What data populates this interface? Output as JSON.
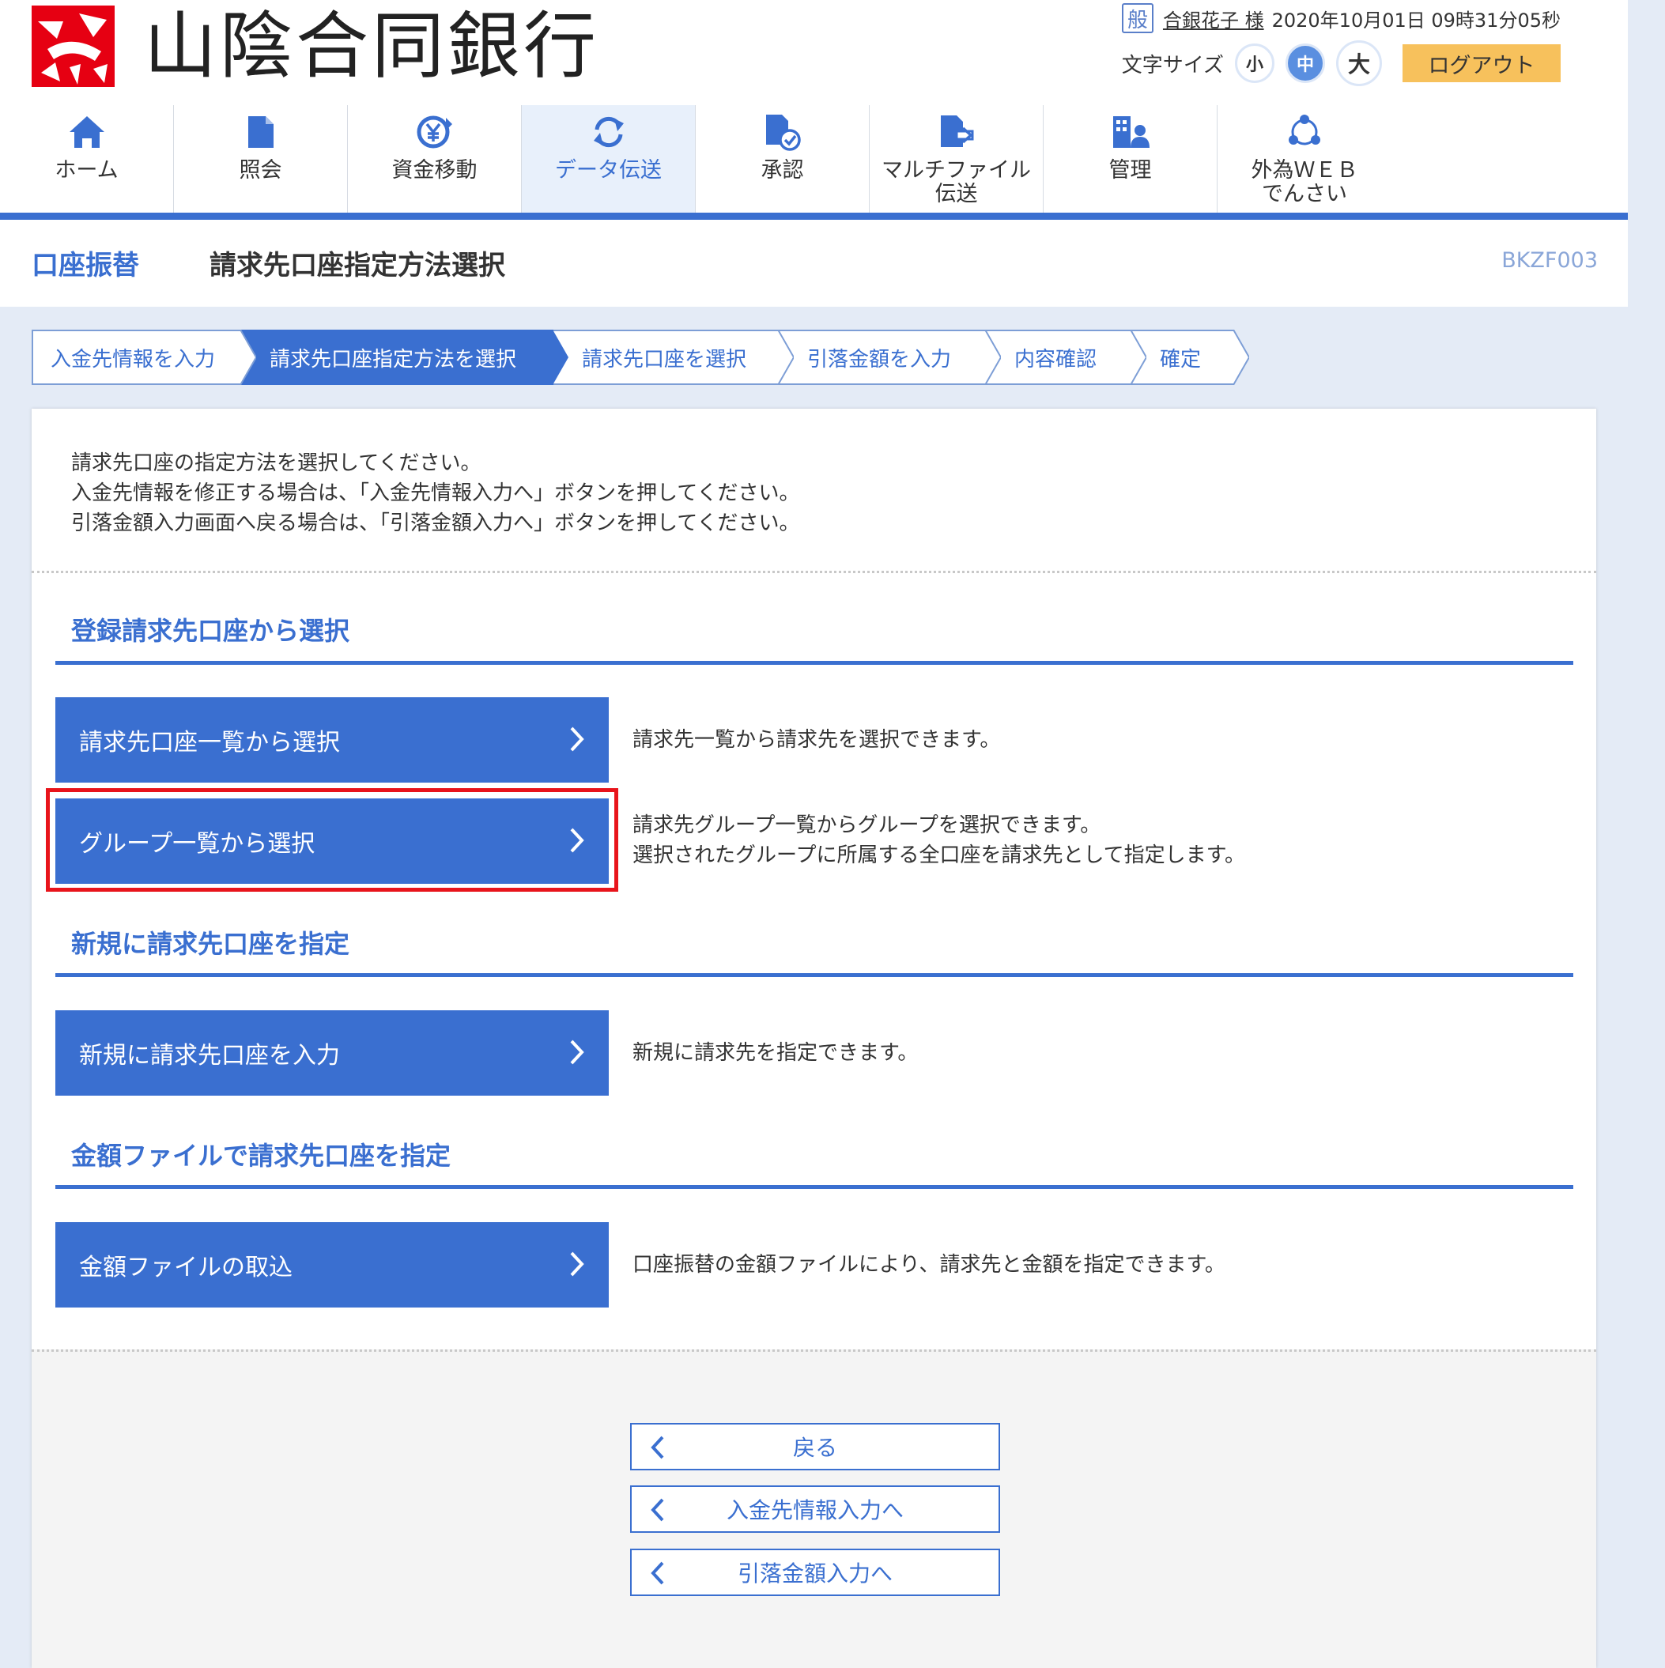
{
  "header": {
    "bank_name": "山陰合同銀行",
    "badge": "般",
    "user_name": "合銀花子 様",
    "datetime": "2020年10月01日 09時31分05秒",
    "font_size_label": "文字サイズ",
    "font_small": "小",
    "font_medium": "中",
    "font_large": "大",
    "logout": "ログアウト"
  },
  "nav": {
    "items": [
      {
        "label": "ホーム",
        "icon": "home-icon"
      },
      {
        "label": "照会",
        "icon": "document-icon"
      },
      {
        "label": "資金移動",
        "icon": "yen-transfer-icon"
      },
      {
        "label": "データ伝送",
        "icon": "refresh-icon",
        "active": true
      },
      {
        "label": "承認",
        "icon": "approve-document-icon"
      },
      {
        "label": "マルチファイル",
        "label2": "伝送",
        "icon": "multi-file-icon"
      },
      {
        "label": "管理",
        "icon": "admin-icon"
      },
      {
        "label": "外為ＷＥＢ",
        "label2": "でんさい",
        "icon": "network-icon"
      }
    ]
  },
  "title": {
    "category": "口座振替",
    "main": "請求先口座指定方法選択",
    "screen_id": "BKZF003"
  },
  "steps": [
    "入金先情報を入力",
    "請求先口座指定方法を選択",
    "請求先口座を選択",
    "引落金額を入力",
    "内容確認",
    "確定"
  ],
  "intro": {
    "line1": "請求先口座の指定方法を選択してください。",
    "line2": "入金先情報を修正する場合は、「入金先情報入力へ」ボタンを押してください。",
    "line3": "引落金額入力画面へ戻る場合は、「引落金額入力へ」ボタンを押してください。"
  },
  "sections": {
    "registered": {
      "title": "登録請求先口座から選択",
      "btn1": "請求先口座一覧から選択",
      "desc1": "請求先一覧から請求先を選択できます。",
      "btn2": "グループ一覧から選択",
      "desc2a": "請求先グループ一覧からグループを選択できます。",
      "desc2b": "選択されたグループに所属する全口座を請求先として指定します。"
    },
    "new": {
      "title": "新規に請求先口座を指定",
      "btn": "新規に請求先口座を入力",
      "desc": "新規に請求先を指定できます。"
    },
    "file": {
      "title": "金額ファイルで請求先口座を指定",
      "btn": "金額ファイルの取込",
      "desc": "口座振替の金額ファイルにより、請求先と金額を指定できます。"
    }
  },
  "footer": {
    "back": "戻る",
    "to_payee": "入金先情報入力へ",
    "to_amount": "引落金額入力へ"
  },
  "colors": {
    "primary": "#3a6fd0",
    "logout": "#f7c15c",
    "logo": "#e60012",
    "highlight": "#e8141b"
  }
}
